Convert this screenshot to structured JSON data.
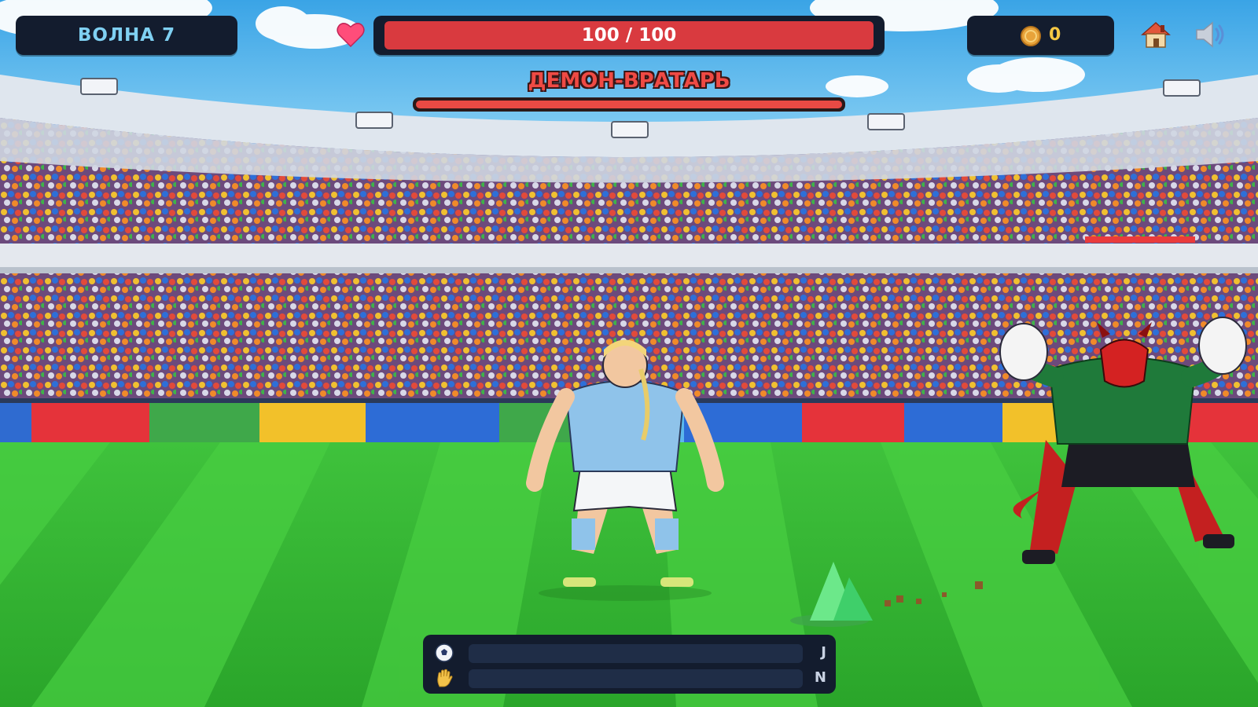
{
  "hud": {
    "wave_label": "ВОЛНА 7",
    "health": {
      "text": "100 / 100",
      "current": 100,
      "max": 100
    },
    "coins": "0",
    "icons": {
      "health": "heart-icon",
      "coins": "coin-icon",
      "home": "home-icon",
      "sound": "speaker-icon"
    }
  },
  "boss": {
    "name": "ДЕМОН-ВРАТАРЬ",
    "health_fraction": 1.0
  },
  "enemy": {
    "health_fraction": 1.0
  },
  "actions": [
    {
      "icon": "soccer-ball-icon",
      "key": "J",
      "charge_fraction": 0
    },
    {
      "icon": "hand-icon",
      "key": "N",
      "charge_fraction": 0
    }
  ],
  "colors": {
    "hud_bg": "#131c2e",
    "health_red": "#d93a3f",
    "boss_name": "#ef4a44",
    "coin_gold": "#f5c844",
    "wave_text": "#7fd0f2"
  }
}
